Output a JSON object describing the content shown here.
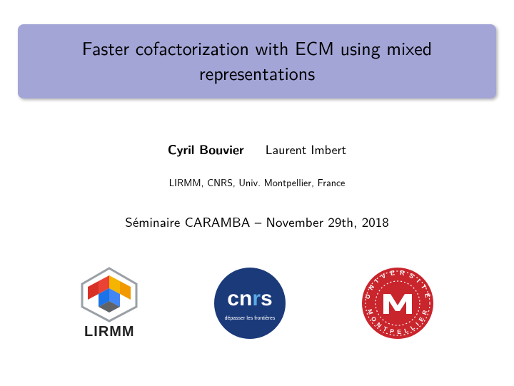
{
  "title": "Faster cofactorization with ECM using mixed representations",
  "authors": {
    "primary": "Cyril Bouvier",
    "secondary": "Laurent Imbert"
  },
  "affiliation": "LIRMM, CNRS, Univ. Montpellier, France",
  "seminar": "Séminaire CARAMBA – November 29th, 2018",
  "logos": {
    "lirmm_label": "LIRMM",
    "cnrs_label": "cnrs",
    "univ_label": "UNIVERSITÉ MONTPELLIER"
  }
}
